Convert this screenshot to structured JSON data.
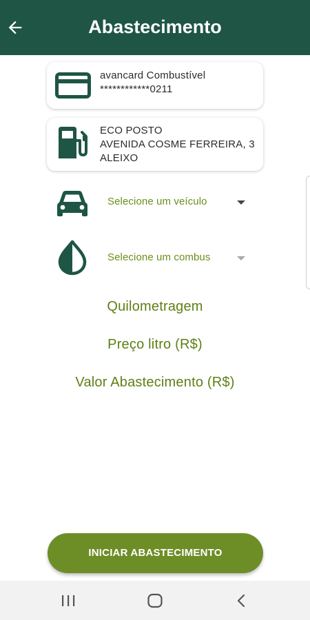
{
  "header": {
    "title": "Abastecimento",
    "back_icon": "arrow-left-icon"
  },
  "card": {
    "icon": "credit-card-icon",
    "name": "avancard Combustível",
    "number": "************0211"
  },
  "station": {
    "icon": "gas-pump-icon",
    "name": "ECO POSTO",
    "address_line1": "AVENIDA COSME FERREIRA, 3",
    "address_line2": "ALEIXO"
  },
  "vehicle": {
    "icon": "car-icon",
    "selected": "Selecione um veículo"
  },
  "fuel": {
    "icon": "drop-icon",
    "selected": "Selecione um combus"
  },
  "fields": {
    "mileage": "Quilometragem",
    "price_per_liter": "Preço litro (R$)",
    "total_value": "Valor Abastecimento (R$)"
  },
  "actions": {
    "start_label": "INICIAR ABASTECIMENTO"
  },
  "navbar": {
    "recents_icon": "recents-icon",
    "home_icon": "home-icon",
    "back_icon": "back-chevron-icon"
  },
  "colors": {
    "header": "#1e5545",
    "accent_text": "#6a8f1b",
    "button": "#6d8d27",
    "icon": "#1e5545"
  }
}
